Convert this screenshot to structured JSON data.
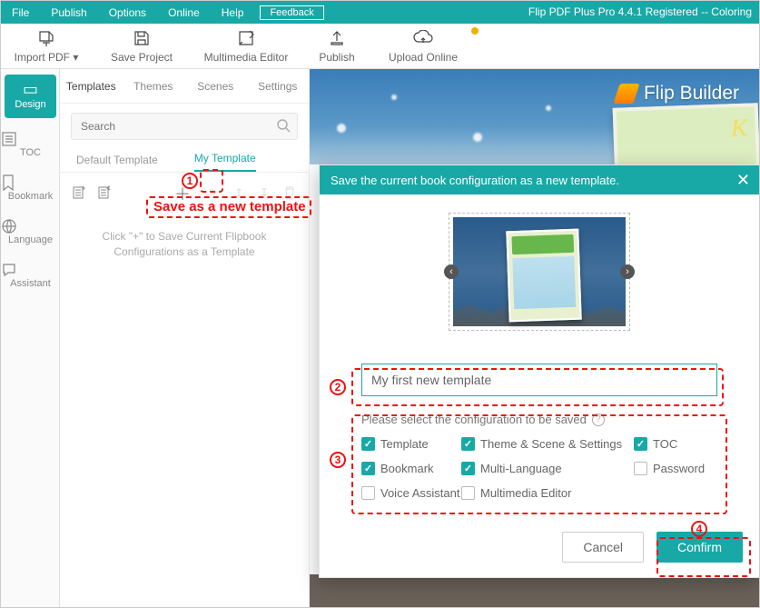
{
  "menubar": {
    "items": [
      "File",
      "Publish",
      "Options",
      "Online",
      "Help"
    ],
    "feedback": "Feedback",
    "title": "Flip PDF Plus Pro 4.4.1 Registered -- Coloring"
  },
  "toolbar": {
    "import": "Import PDF ▾",
    "save": "Save Project",
    "multimedia": "Multimedia Editor",
    "publish": "Publish",
    "upload": "Upload Online"
  },
  "leftrail": {
    "design": "Design",
    "toc": "TOC",
    "bookmark": "Bookmark",
    "language": "Language",
    "assistant": "Assistant"
  },
  "tabs": {
    "templates": "Templates",
    "themes": "Themes",
    "scenes": "Scenes",
    "settings": "Settings"
  },
  "search": {
    "placeholder": "Search"
  },
  "subtabs": {
    "default": "Default Template",
    "my": "My Template"
  },
  "hint": {
    "line1": "Click \"+\" to Save Current Flipbook",
    "line2": "Configurations as a Template"
  },
  "preview": {
    "brand": "Flip Builder",
    "bookletter": "K"
  },
  "modal": {
    "title": "Save the current book configuration as a new template.",
    "input_value": "My first new template",
    "select_label": "Please select the configuration to be saved",
    "opts": {
      "template": "Template",
      "theme": "Theme & Scene & Settings",
      "toc": "TOC",
      "bookmark": "Bookmark",
      "multilang": "Multi-Language",
      "password": "Password",
      "voice": "Voice Assistant",
      "mmeditor": "Multimedia Editor"
    },
    "cancel": "Cancel",
    "confirm": "Confirm"
  },
  "annotations": {
    "save_as": "Save as a new template",
    "n1": "1",
    "n2": "2",
    "n3": "3",
    "n4": "4"
  }
}
